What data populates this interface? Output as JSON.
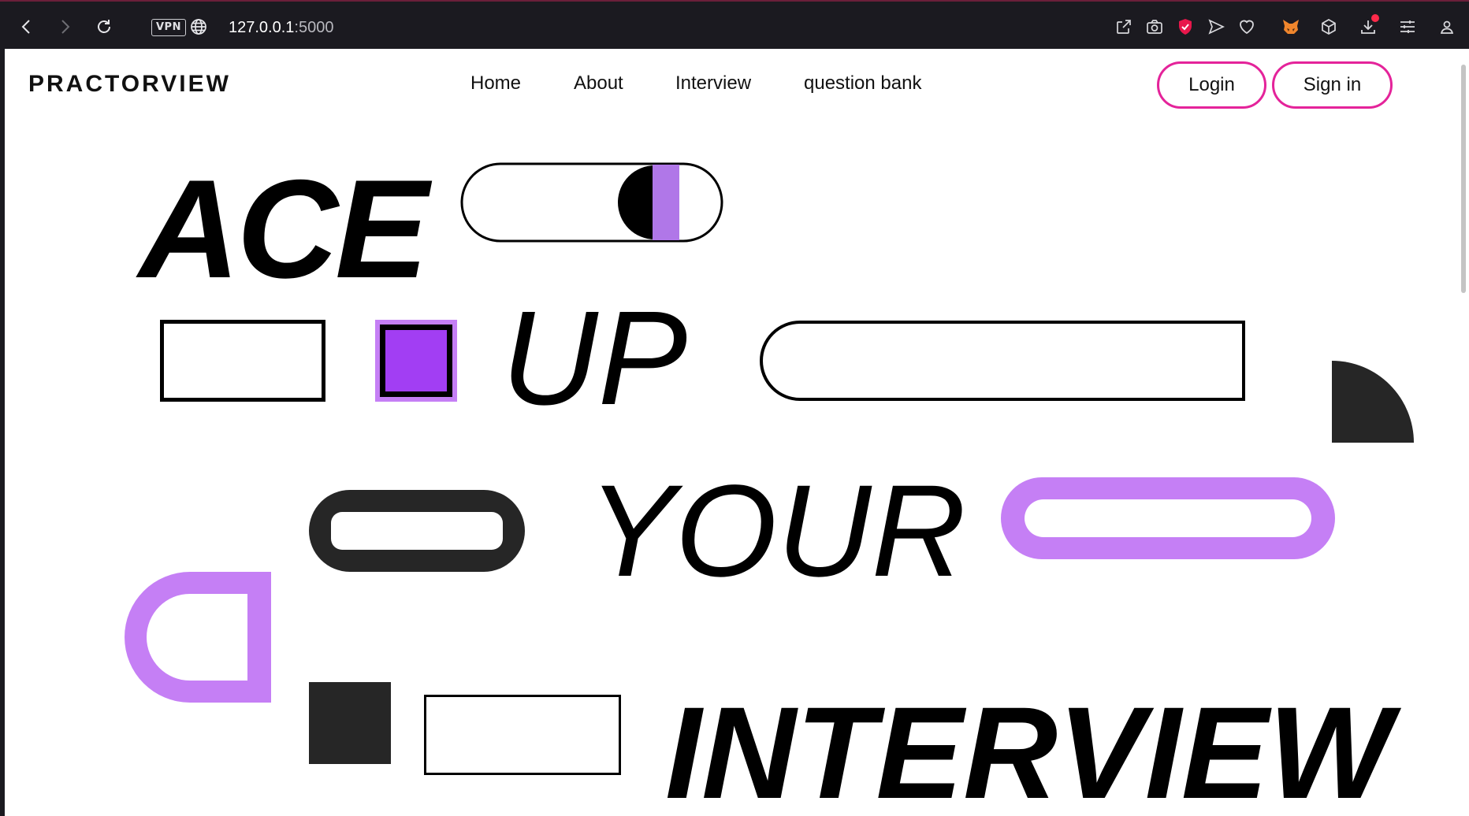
{
  "browser": {
    "vpn_label": "VPN",
    "url_host": "127.0.0.1",
    "url_port": ":5000",
    "toolbar_icons": [
      "share-icon",
      "camera-icon",
      "shield-icon",
      "send-icon",
      "heart-icon",
      "fox-extension-icon",
      "cube-icon",
      "download-icon",
      "settings-sliders-icon",
      "profile-icon"
    ]
  },
  "site": {
    "brand": "PRACTORVIEW",
    "nav": {
      "home": "Home",
      "about": "About",
      "interview": "Interview",
      "question_bank": "question bank"
    },
    "login_label": "Login",
    "signin_label": "Sign in"
  },
  "hero": {
    "line1": "ACE",
    "line2": "UP",
    "line3": "YOUR",
    "line4": "INTERVIEW"
  },
  "colors": {
    "accent_purple": "#c57ff5",
    "deep_purple": "#a23ef3",
    "toggle_purple": "#b077e8",
    "dark_shape": "#262626",
    "button_border": "#e4239a"
  }
}
